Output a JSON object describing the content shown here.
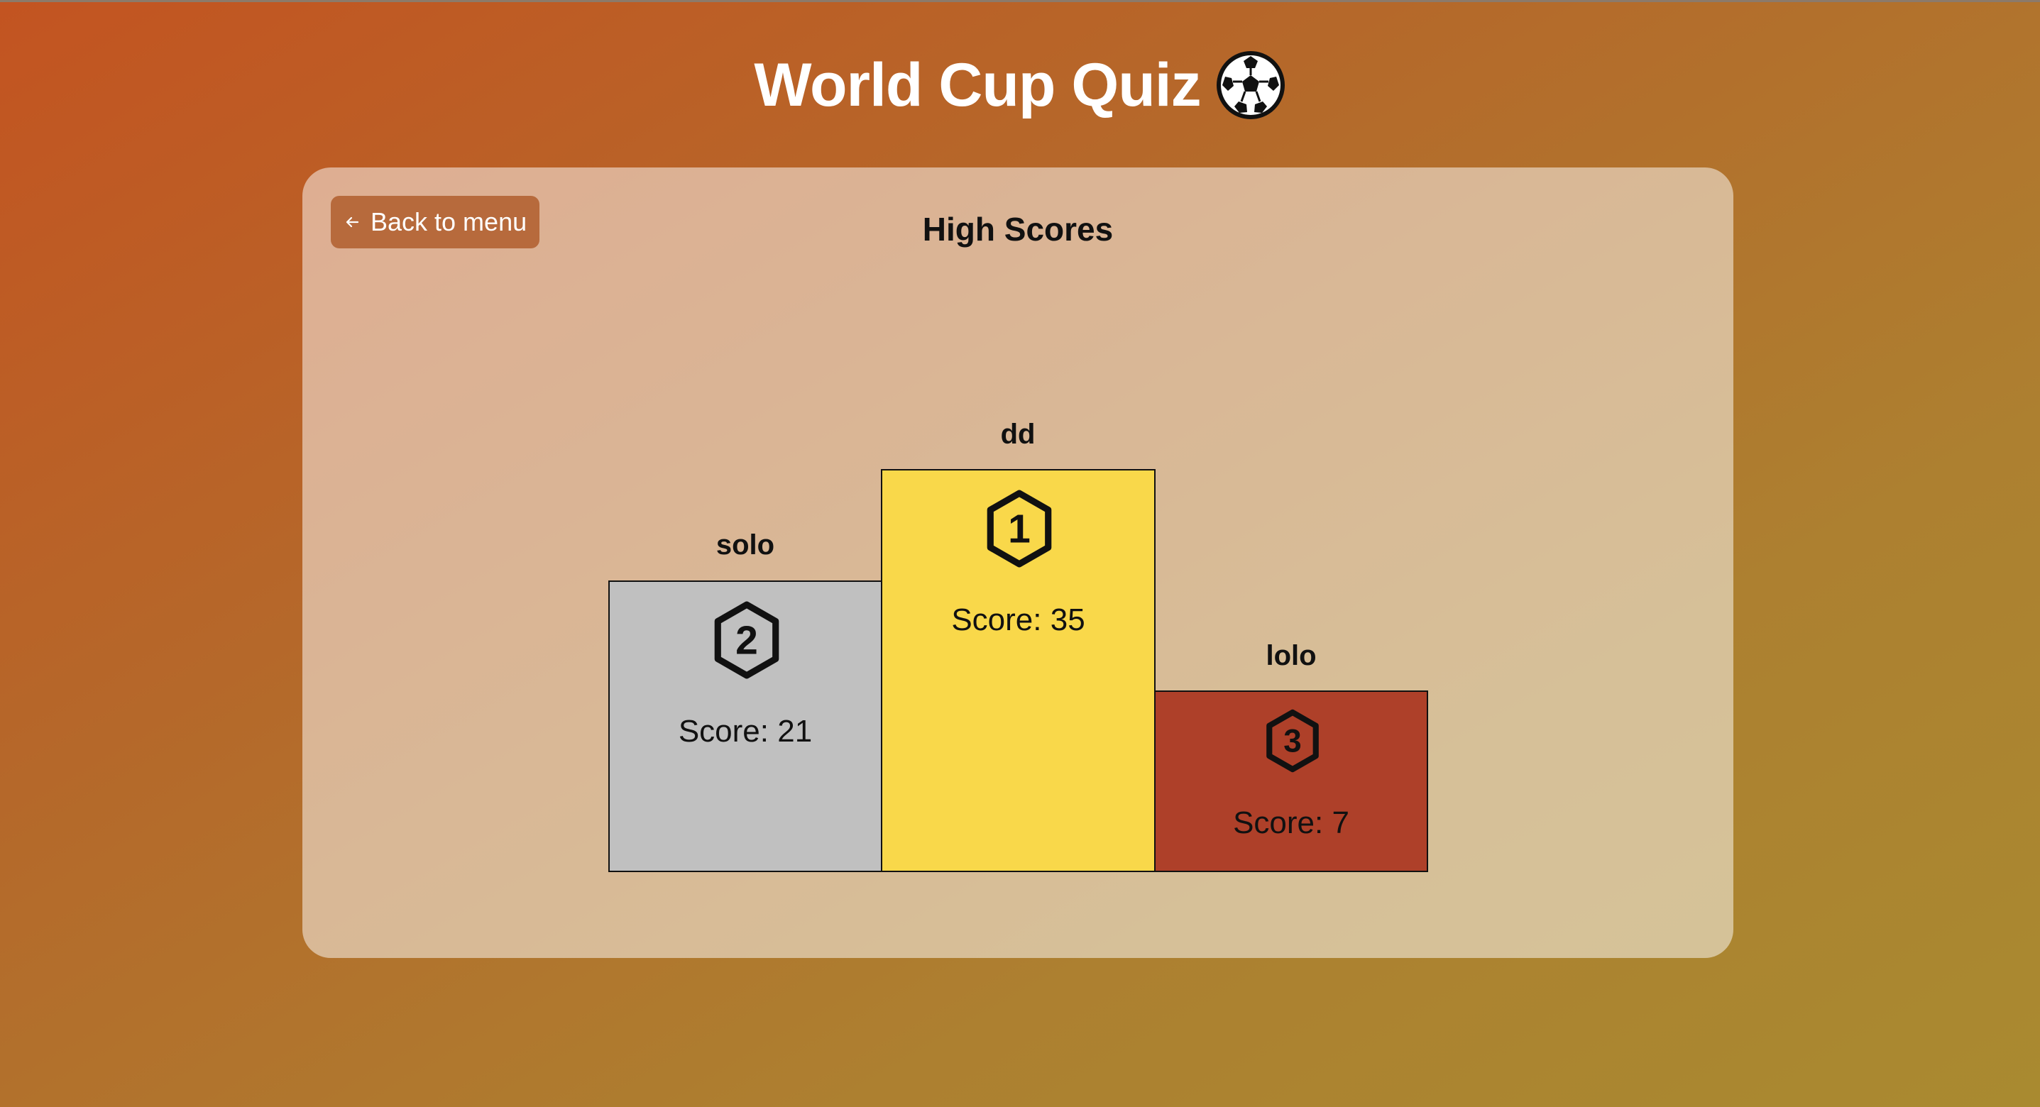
{
  "app": {
    "title": "World Cup Quiz",
    "title_icon": "soccer-ball-icon"
  },
  "panel": {
    "back_label": "Back to menu",
    "back_icon": "arrow-left-icon",
    "title": "High Scores"
  },
  "podium": [
    {
      "place": 2,
      "name": "solo",
      "score_text": "Score: 21",
      "score": 21,
      "color": "#c0c0c0",
      "icon": "rank-2-hexagon-icon"
    },
    {
      "place": 1,
      "name": "dd",
      "score_text": "Score: 35",
      "score": 35,
      "color": "#f9d84a",
      "icon": "rank-1-hexagon-icon"
    },
    {
      "place": 3,
      "name": "lolo",
      "score_text": "Score: 7",
      "score": 7,
      "color": "#ae4029",
      "icon": "rank-3-hexagon-icon"
    }
  ]
}
